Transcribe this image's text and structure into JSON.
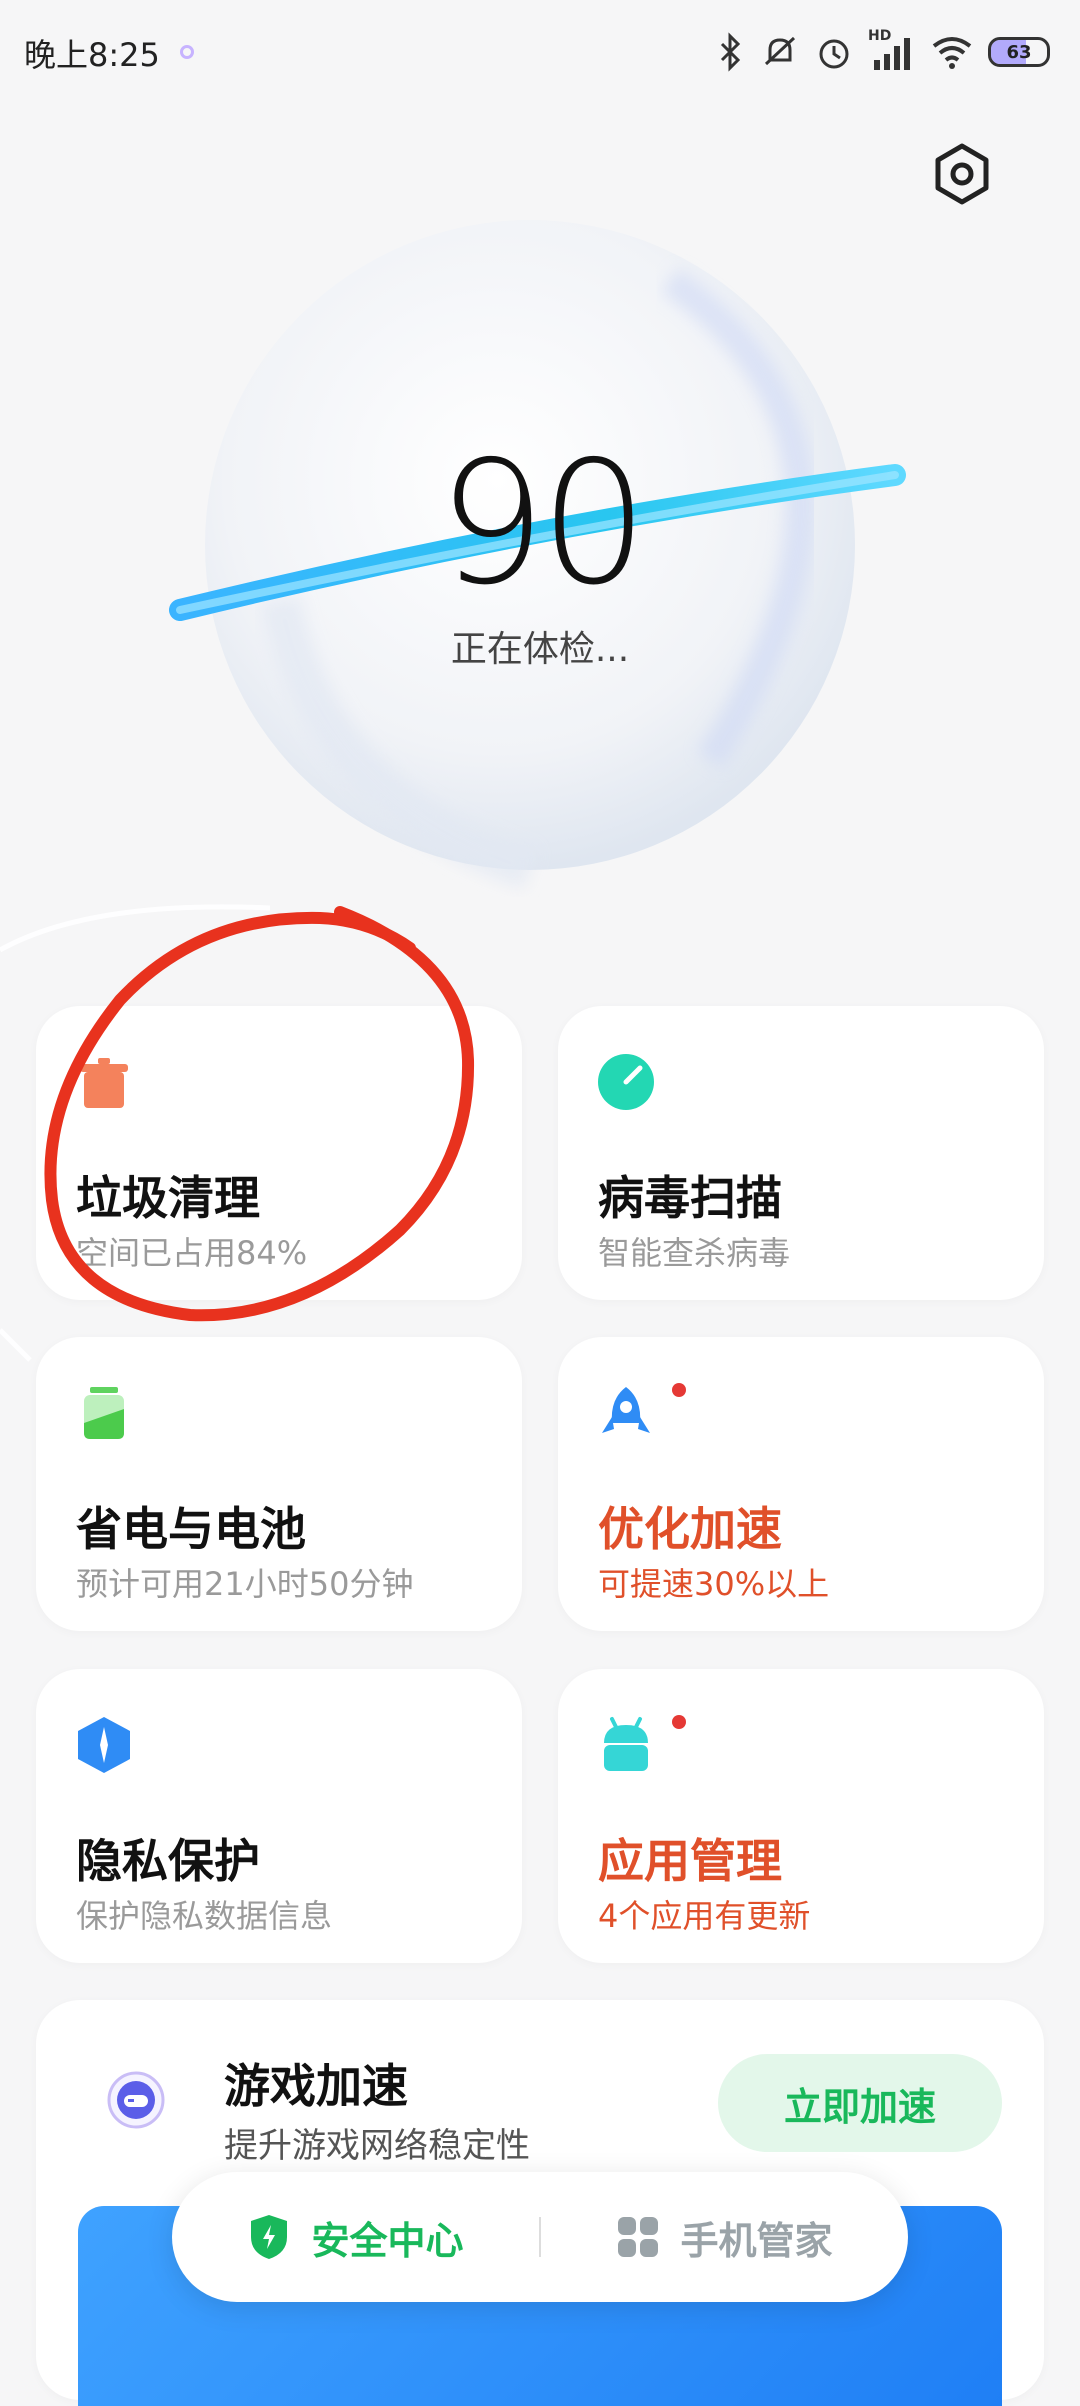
{
  "status_bar": {
    "time": "晚上8:25",
    "network_label": "HD",
    "battery_level": "63"
  },
  "health": {
    "score": "90",
    "status_text": "正在体检..."
  },
  "cards": [
    {
      "title": "垃圾清理",
      "subtitle": "空间已占用84%",
      "icon": "trash-icon",
      "highlight": false,
      "badge": false
    },
    {
      "title": "病毒扫描",
      "subtitle": "智能查杀病毒",
      "icon": "virus-scan-icon",
      "highlight": false,
      "badge": false
    },
    {
      "title": "省电与电池",
      "subtitle": "预计可用21小时50分钟",
      "icon": "battery-icon",
      "highlight": false,
      "badge": false
    },
    {
      "title": "优化加速",
      "subtitle": "可提速30%以上",
      "icon": "rocket-icon",
      "highlight": true,
      "badge": true
    },
    {
      "title": "隐私保护",
      "subtitle": "保护隐私数据信息",
      "icon": "privacy-icon",
      "highlight": false,
      "badge": false
    },
    {
      "title": "应用管理",
      "subtitle": "4个应用有更新",
      "icon": "android-icon",
      "highlight": true,
      "badge": true
    }
  ],
  "game_boost": {
    "title": "游戏加速",
    "subtitle": "提升游戏网络稳定性",
    "button_label": "立即加速",
    "icon": "gamepad-icon"
  },
  "bottom_nav": {
    "security_label": "安全中心",
    "manager_label": "手机管家"
  },
  "colors": {
    "accent_green": "#19b85b",
    "highlight_orange": "#e0502a",
    "annotation_red": "#e8321e"
  }
}
